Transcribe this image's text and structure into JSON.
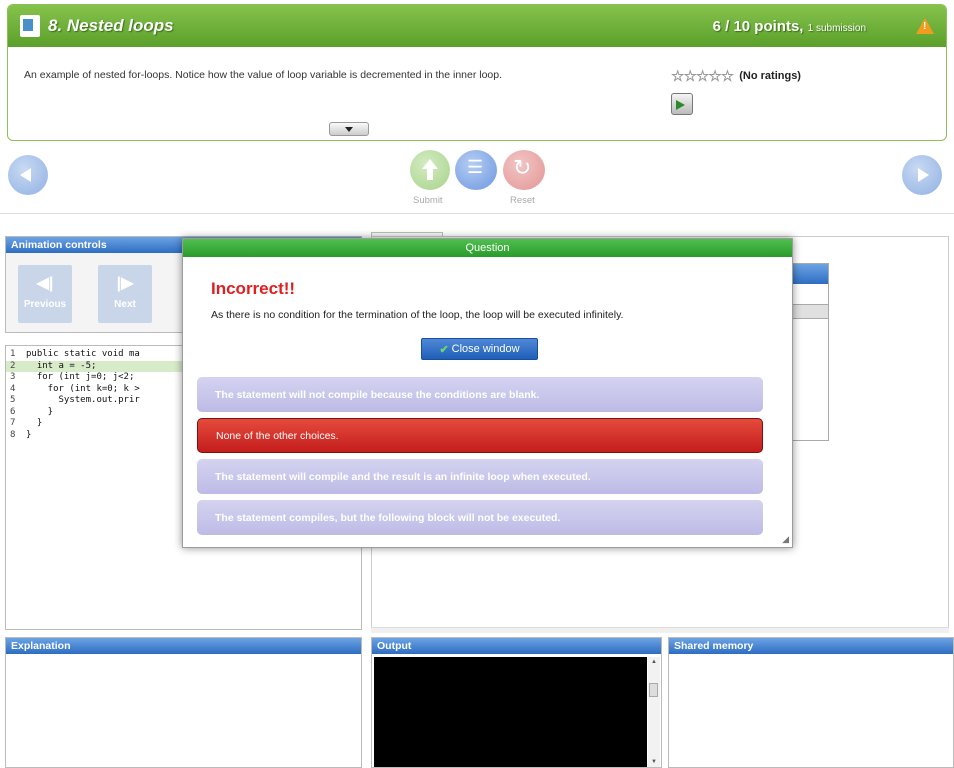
{
  "header": {
    "title": "8. Nested loops",
    "points": "6 / 10 points,",
    "submissions": "1 submission",
    "description": "An example of nested for-loops. Notice how the value of loop variable is decremented in the inner loop.",
    "stars": "☆☆☆☆☆",
    "rating_text": "(No ratings)"
  },
  "toolbar": {
    "submit_label": "Submit",
    "reset_label": "Reset"
  },
  "animation": {
    "title": "Animation controls",
    "previous_label": "Previous",
    "next_label": "Next"
  },
  "code": {
    "lines": [
      {
        "num": "1",
        "text": "public static void ma"
      },
      {
        "num": "2",
        "text": "  int a = -5;"
      },
      {
        "num": "3",
        "text": "  for (int j=0; j<2;"
      },
      {
        "num": "4",
        "text": "    for (int k=0; k >"
      },
      {
        "num": "5",
        "text": "      System.out.prir"
      },
      {
        "num": "6",
        "text": "    }"
      },
      {
        "num": "7",
        "text": "  }"
      },
      {
        "num": "8",
        "text": "}"
      }
    ],
    "highlighted_line": 2
  },
  "panels": {
    "explanation": "Explanation",
    "output": "Output",
    "shared_memory": "Shared memory"
  },
  "modal": {
    "header": "Question",
    "title": "Incorrect!!",
    "message": "As there is no condition for the termination of the loop, the loop will be executed infinitely.",
    "close_label": "Close window",
    "choices": [
      "The statement will not compile because the conditions are blank.",
      "None of the other choices.",
      "The statement will compile and the result is an infinite loop when executed.",
      "The statement compiles, but the following block will not be executed."
    ],
    "selected_choice": "None of the other choices.",
    "resize_grip": "◢"
  },
  "colors": {
    "header_green": "#5aa02a",
    "panel_blue": "#2d6dc2",
    "incorrect_red": "#e02020",
    "selected_choice": "#c41d1d",
    "choice_lavender": "#bdbbe6"
  }
}
